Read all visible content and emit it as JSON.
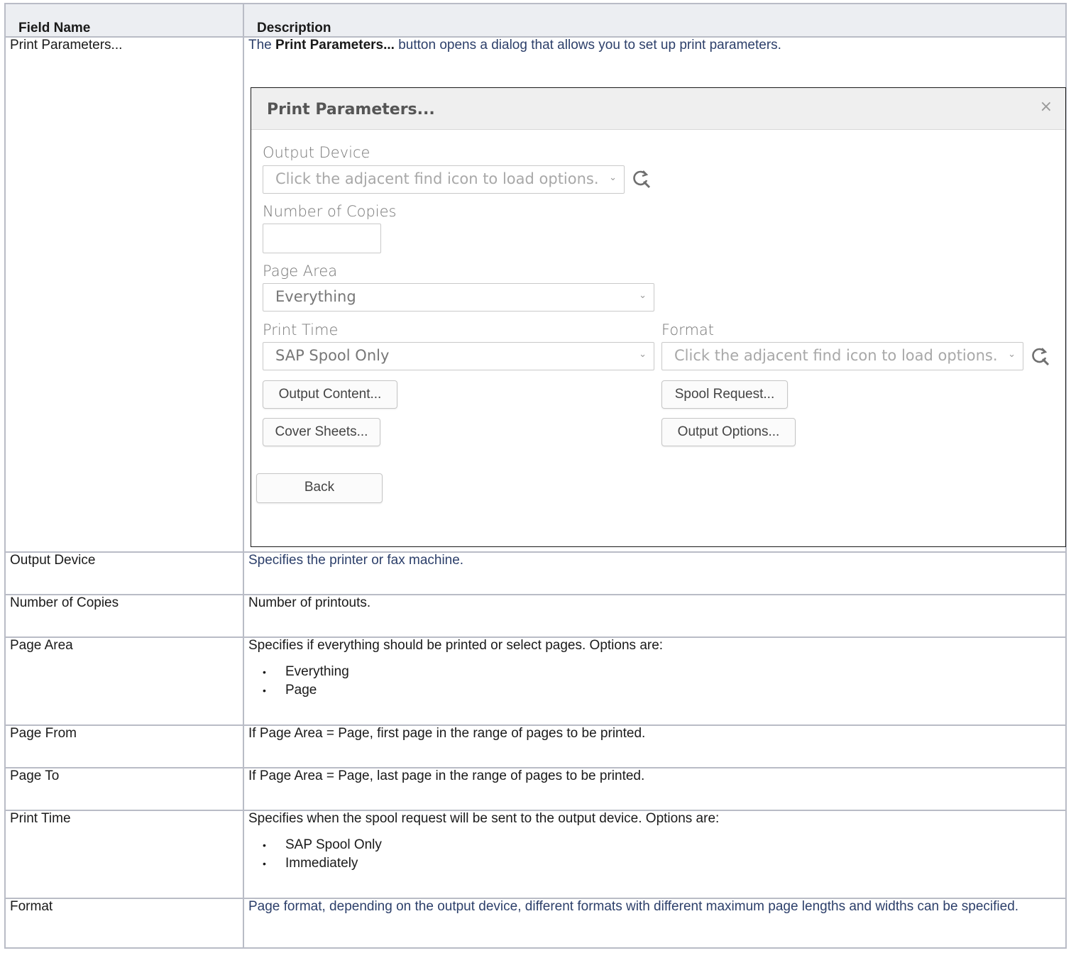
{
  "table": {
    "header": {
      "field_name": "Field Name",
      "description": "Description"
    },
    "rows": [
      {
        "name": "Print Parameters...",
        "desc_prefix": "The ",
        "desc_bold": "Print Parameters...",
        "desc_suffix": " button opens a dialog that allows you to set up print parameters."
      },
      {
        "name": "Output Device",
        "desc": "Specifies the printer or fax machine."
      },
      {
        "name": "Number of Copies",
        "desc": "Number of printouts."
      },
      {
        "name": "Page Area",
        "desc": "Specifies if everything should be printed or select pages. Options are:",
        "options": [
          "Everything",
          "Page"
        ]
      },
      {
        "name": "Page From",
        "desc": "If Page Area = Page, first page in the range of pages to be printed."
      },
      {
        "name": "Page To",
        "desc": "If Page Area = Page, last page in the range of pages to be printed."
      },
      {
        "name": "Print Time",
        "desc": "Specifies when the spool request will be sent to the output device. Options are:",
        "options": [
          "SAP Spool Only",
          "Immediately"
        ]
      },
      {
        "name": "Format",
        "desc": "Page format, depending on the output device, different formats with different maximum page lengths and widths can be specified."
      }
    ]
  },
  "dialog": {
    "title": "Print Parameters...",
    "close": "×",
    "output_device_label": "Output Device",
    "output_device_placeholder": "Click the adjacent find icon to load options.",
    "copies_label": "Number of Copies",
    "copies_value": "",
    "page_area_label": "Page Area",
    "page_area_value": "Everything",
    "print_time_label": "Print Time",
    "print_time_value": "SAP Spool Only",
    "format_label": "Format",
    "format_placeholder": "Click the adjacent find icon to load options.",
    "buttons": {
      "output_content": "Output Content...",
      "spool_request": "Spool Request...",
      "cover_sheets": "Cover Sheets...",
      "output_options": "Output Options...",
      "back": "Back"
    },
    "icons": {
      "find": "search-refresh-icon",
      "chevron": "chevron-down-icon"
    }
  }
}
